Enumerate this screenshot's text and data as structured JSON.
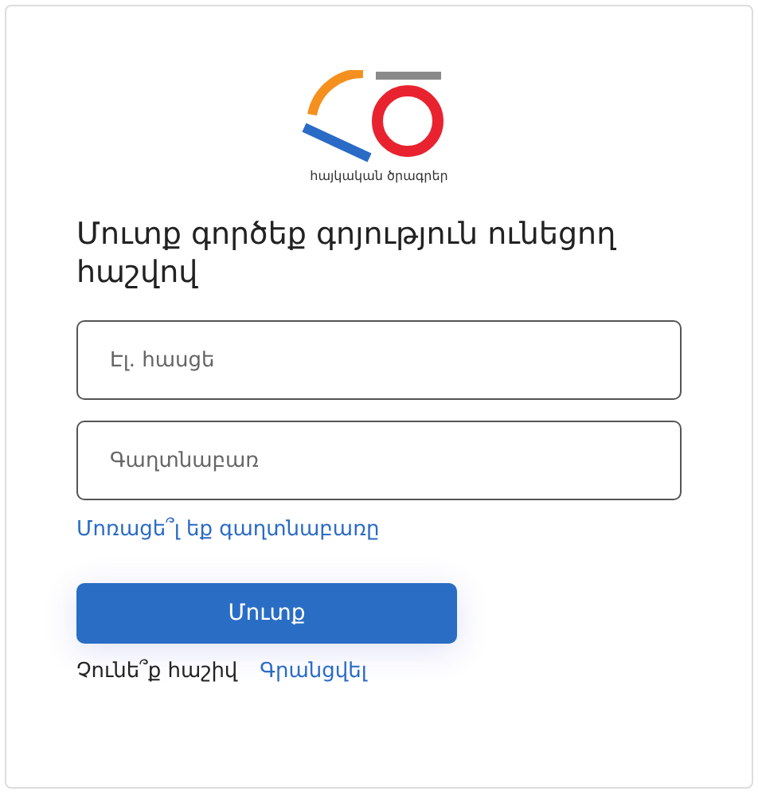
{
  "logo": {
    "caption": "հայկական ծրագրեր"
  },
  "title": "Մուտք գործեք գոյություն ունեցող հաշվով",
  "fields": [
    {
      "placeholder": "Էլ. հասցե"
    },
    {
      "placeholder": "Գաղտնաբառ"
    }
  ],
  "forgot_link": "Մոռացե՞լ եք գաղտնաբառը",
  "submit_button": "Մուտք",
  "signup": {
    "prompt": "Չունե՞ք հաշիվ",
    "link": "Գրանցվել"
  }
}
